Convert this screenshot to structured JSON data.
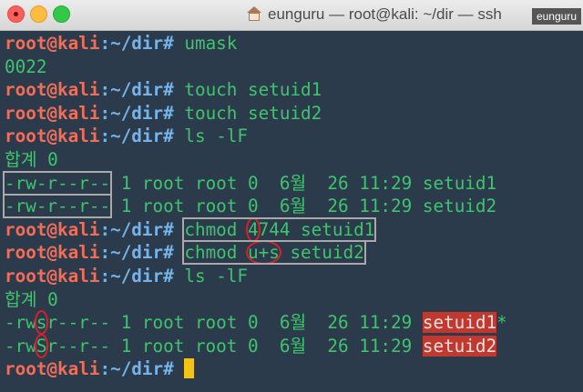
{
  "window": {
    "title": "eunguru — root@kali: ~/dir — ssh",
    "badge": "eunguru"
  },
  "colors": {
    "background": "#2c3b4c",
    "user": "#f26e58",
    "path": "#74b4ea",
    "text": "#3fc46d",
    "highlight": "#c2382f",
    "cursor": "#f0c419"
  },
  "terminal": {
    "lines": [
      [
        {
          "t": "root@kali",
          "c": "user"
        },
        {
          "t": ":~/dir#",
          "c": "path"
        },
        {
          "t": " umask"
        }
      ],
      [
        {
          "t": "0022"
        }
      ],
      [
        {
          "t": "root@kali",
          "c": "user"
        },
        {
          "t": ":~/dir#",
          "c": "path"
        },
        {
          "t": " touch setuid1"
        }
      ],
      [
        {
          "t": "root@kali",
          "c": "user"
        },
        {
          "t": ":~/dir#",
          "c": "path"
        },
        {
          "t": " touch setuid2"
        }
      ],
      [
        {
          "t": "root@kali",
          "c": "user"
        },
        {
          "t": ":~/dir#",
          "c": "path"
        },
        {
          "t": " ls -lF"
        }
      ],
      [
        {
          "t": "합계 0"
        }
      ],
      [
        {
          "t": "-rw-r--r--",
          "c": "boxed"
        },
        {
          "t": " 1 root root 0  6월  26 11:29 setuid1"
        }
      ],
      [
        {
          "t": "-rw-r--r--",
          "c": "boxed"
        },
        {
          "t": " 1 root root 0  6월  26 11:29 setuid2"
        }
      ],
      [
        {
          "t": "root@kali",
          "c": "user"
        },
        {
          "t": ":~/dir#",
          "c": "path"
        },
        {
          "t": " "
        },
        {
          "t": "chmod ",
          "c": "boxed",
          "group": [
            {
              "t": "chmod "
            },
            {
              "t": "4",
              "c": "circle"
            },
            {
              "t": "744 setuid1"
            }
          ]
        }
      ],
      [
        {
          "t": "root@kali",
          "c": "user"
        },
        {
          "t": ":~/dir#",
          "c": "path"
        },
        {
          "t": " "
        },
        {
          "t": "chmod ",
          "c": "boxed",
          "group": [
            {
              "t": "chmod "
            },
            {
              "t": "u+s",
              "c": "circle"
            },
            {
              "t": " setuid2"
            }
          ]
        }
      ],
      [
        {
          "t": "root@kali",
          "c": "user"
        },
        {
          "t": ":~/dir#",
          "c": "path"
        },
        {
          "t": " ls -lF"
        }
      ],
      [
        {
          "t": "합계 0"
        }
      ],
      [
        {
          "t": "-rw"
        },
        {
          "t": "s",
          "c": "circle"
        },
        {
          "t": "r--r-- 1 root root 0  6월  26 11:29 "
        },
        {
          "t": "setuid1",
          "c": "hl"
        },
        {
          "t": "*"
        }
      ],
      [
        {
          "t": "-rw"
        },
        {
          "t": "S",
          "c": "circle"
        },
        {
          "t": "r--r-- 1 root root 0  6월  26 11:29 "
        },
        {
          "t": "setuid2",
          "c": "hl"
        }
      ],
      [
        {
          "t": "root@kali",
          "c": "user"
        },
        {
          "t": ":~/dir#",
          "c": "path"
        },
        {
          "t": " "
        },
        {
          "t": "",
          "c": "cursor"
        }
      ]
    ]
  }
}
